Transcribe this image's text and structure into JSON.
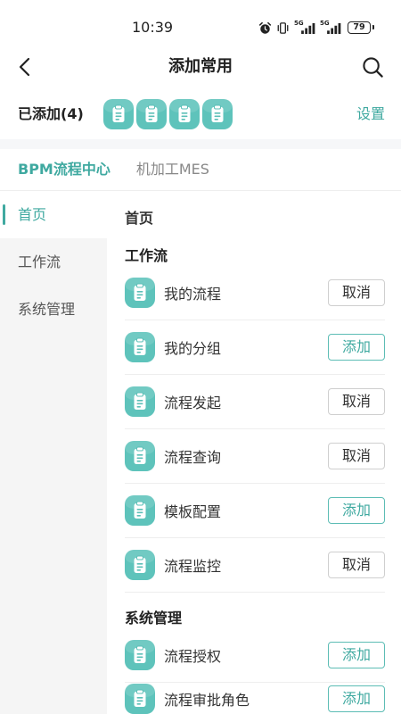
{
  "status_bar": {
    "time": "10:39",
    "network_1": "5G",
    "network_2": "5G",
    "battery": "79",
    "icons": [
      "alarm-icon",
      "vibrate-icon",
      "signal-5g-icon",
      "signal-5g-icon",
      "battery-icon"
    ]
  },
  "header": {
    "title": "添加常用",
    "back_icon": "chevron-left-icon",
    "search_icon": "search-icon"
  },
  "added": {
    "label": "已添加(4)",
    "icons": [
      "clipboard-icon",
      "clipboard-icon",
      "clipboard-icon",
      "clipboard-icon"
    ],
    "settings_label": "设置"
  },
  "tabs": [
    {
      "label": "BPM流程中心",
      "active": true
    },
    {
      "label": "机加工MES",
      "active": false
    }
  ],
  "sidebar": {
    "items": [
      {
        "label": "首页",
        "active": true
      },
      {
        "label": "工作流",
        "active": false
      },
      {
        "label": "系统管理",
        "active": false
      }
    ]
  },
  "content": {
    "heading": "首页",
    "sections": [
      {
        "title": "工作流",
        "items": [
          {
            "label": "我的流程",
            "button": "取消",
            "added": true,
            "icon": "clipboard-icon"
          },
          {
            "label": "我的分组",
            "button": "添加",
            "added": false,
            "icon": "clipboard-icon"
          },
          {
            "label": "流程发起",
            "button": "取消",
            "added": true,
            "icon": "clipboard-icon"
          },
          {
            "label": "流程查询",
            "button": "取消",
            "added": true,
            "icon": "clipboard-icon"
          },
          {
            "label": "模板配置",
            "button": "添加",
            "added": false,
            "icon": "clipboard-icon"
          },
          {
            "label": "流程监控",
            "button": "取消",
            "added": true,
            "icon": "clipboard-icon"
          }
        ]
      },
      {
        "title": "系统管理",
        "items": [
          {
            "label": "流程授权",
            "button": "添加",
            "added": false,
            "icon": "clipboard-icon"
          },
          {
            "label": "流程审批角色",
            "button": "添加",
            "added": false,
            "icon": "clipboard-icon"
          }
        ]
      }
    ]
  },
  "colors": {
    "accent": "#3fa9a0",
    "icon_bg": "#5ec3bb",
    "sidebar_bg": "#f5f5f5",
    "cancel_border": "#cfcfcf",
    "divider": "#eeeeee",
    "text": "#333333"
  }
}
